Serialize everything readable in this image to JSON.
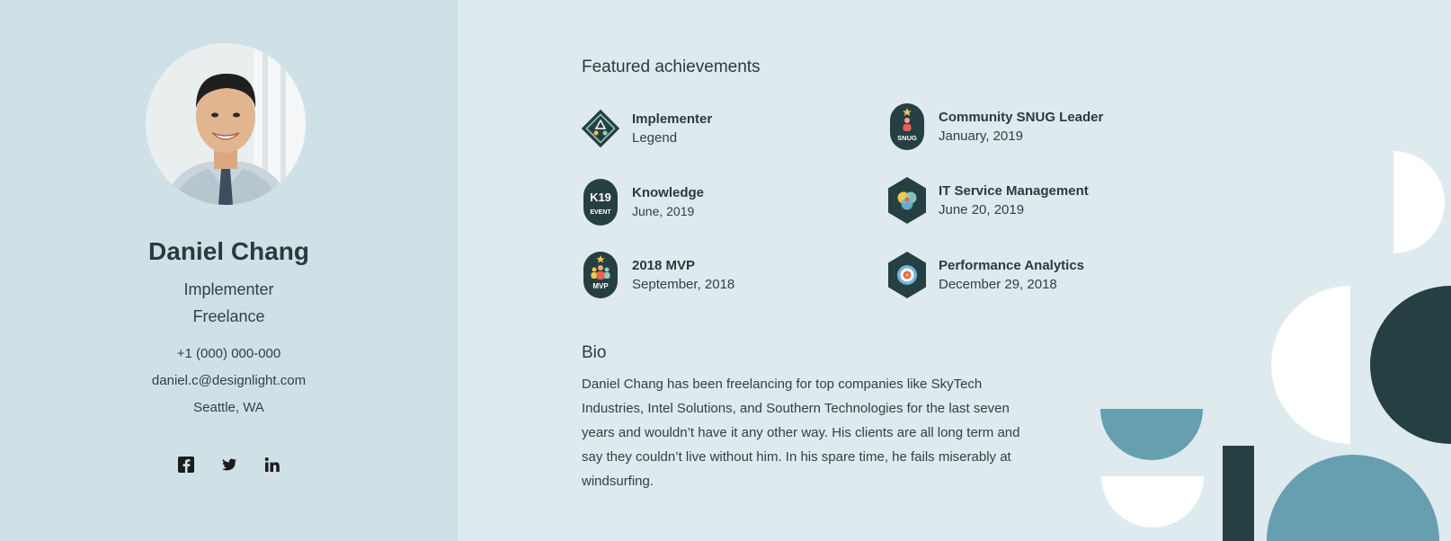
{
  "profile": {
    "name": "Daniel Chang",
    "role": "Implementer",
    "company": "Freelance",
    "phone": "+1 (000) 000-000",
    "email": "daniel.c@designlight.com",
    "location": "Seattle, WA"
  },
  "socials": [
    {
      "icon": "facebook-icon"
    },
    {
      "icon": "twitter-icon"
    },
    {
      "icon": "linkedin-icon"
    }
  ],
  "achievements": {
    "title": "Featured achievements",
    "items": [
      {
        "title": "Implementer",
        "subtitle": "Legend",
        "badge_text": ""
      },
      {
        "title": "Community SNUG Leader",
        "subtitle": "January, 2019",
        "badge_text": "SNUG"
      },
      {
        "title": "Knowledge",
        "subtitle": "June, 2019",
        "badge_text": "K19",
        "badge_subtext": "EVENT"
      },
      {
        "title": "IT Service Management",
        "subtitle": "June 20, 2019",
        "badge_text": ""
      },
      {
        "title": "2018 MVP",
        "subtitle": "September, 2018",
        "badge_text": "MVP"
      },
      {
        "title": "Performance Analytics",
        "subtitle": "December 29, 2018",
        "badge_text": ""
      }
    ]
  },
  "bio": {
    "title": "Bio",
    "text": "Daniel Chang has been freelancing for top companies like SkyTech Industries, Intel Solutions, and Southern Technologies for the last seven years and wouldn’t have it any other way. His clients are all long term and say they couldn’t live without him. In his spare time, he fails miserably at windsurfing."
  },
  "colors": {
    "left_bg": "#cfe1e7",
    "right_bg": "#deeaee",
    "dark": "#263f43",
    "teal": "#66a0b0",
    "white": "#ffffff"
  }
}
